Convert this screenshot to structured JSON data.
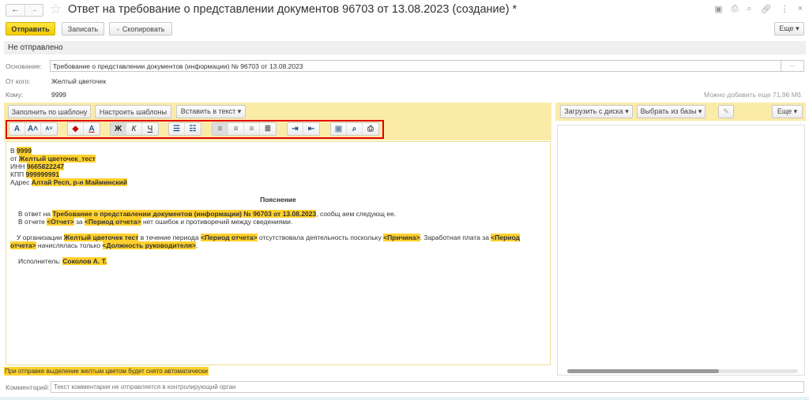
{
  "window": {
    "title": "Ответ на требование о представлении документов 96703 от 13.08.2023 (создание) *",
    "back": "←",
    "forward": "→"
  },
  "toolbar": {
    "send": "Отправить",
    "save": "Записать",
    "copy": "Скопировать",
    "more": "Еще ▾"
  },
  "status": "Не отправлено",
  "fields": {
    "basis_label": "Основание:",
    "basis_value": "Требование о представлении документов (информации) № 96703 от 13.08.2023",
    "basis_more": "...",
    "from_label": "От кого:",
    "from_value": "Желтый цветочек",
    "to_label": "Кому:",
    "to_value": "9999",
    "space_left": "Можно добавить еще 71,96 Мб."
  },
  "editor_toolbar": {
    "fill_template": "Заполнить по шаблону",
    "setup_templates": "Настроить шаблоны",
    "insert_text": "Вставить в текст ▾",
    "bold": "Ж",
    "italic": "К",
    "underline": "Ч"
  },
  "document": {
    "l1a": "В ",
    "l1b": "9999",
    "l2a": "от ",
    "l2b": "Желтый цветочек_тест",
    "l3a": "ИНН ",
    "l3b": "9665822247",
    "l4a": "КПП ",
    "l4b": "999999991",
    "l5a": "Адрес ",
    "l5b": "Алтай Респ, р-н Майминский",
    "heading": "Пояснение",
    "p1a": "В ответ на ",
    "p1b": "Требование о представлении документов (информации) № 96703 от 13.08.2023",
    "p1c": ", сообщ аем следующ ее.",
    "p2a": "В отчете ",
    "p2b": "<Отчет>",
    "p2c": " за ",
    "p2d": "<Период отчета>",
    "p2e": " нет ошибок и противоречий между сведениями.",
    "p3a": "У организации ",
    "p3b": "Желтый цветочек  тест",
    "p3c": " в течение периода ",
    "p3d": "<Период отчета>",
    "p3e": " отсутствовала деятельность поскольку ",
    "p3f": "<Причина>",
    "p3g": ". Заработная плата за ",
    "p3h": "<Период отчета>",
    "p3i": " начислялась только ",
    "p3j": "<Должность руководителя>",
    "p3k": ".",
    "p4a": "Исполнитель: ",
    "p4b": "Соколов А. Т."
  },
  "attachments": {
    "upload": "Загрузить с диска ▾",
    "select": "Выбрать из базы ▾",
    "more": "Еще ▾"
  },
  "note": "При отправке выделение желтым цветом будет снято автоматически",
  "comment": {
    "label": "Комментарий:",
    "placeholder": "Текст комментария не отправляется в контролирующий орган"
  },
  "colors": {
    "accent": "#f5d313",
    "panel": "#fbeba8",
    "highlight": "#ffd12e",
    "toolbar_border": "#e00000"
  }
}
